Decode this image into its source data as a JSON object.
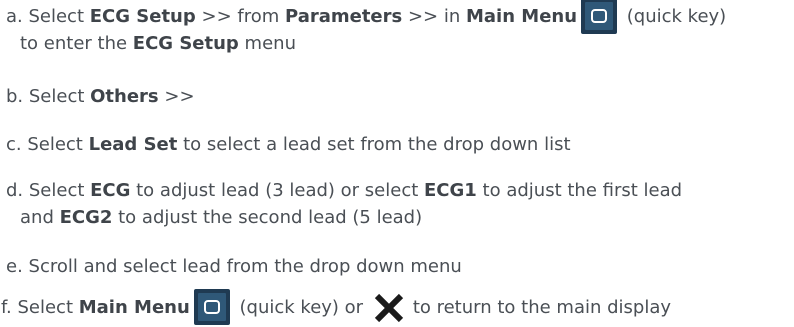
{
  "icons": {
    "quick_key": "main-menu-quick-key-icon",
    "close": "close-icon",
    "quick_key_color": "#1f3a52",
    "close_color": "#1a1a1a"
  },
  "steps": {
    "a": {
      "l1_t1": "a. Select ",
      "l1_b1": "ECG Setup",
      "l1_t2": " >> from ",
      "l1_b2": "Parameters",
      "l1_t3": " >> in ",
      "l1_b3": "Main Menu",
      "l1_t4": " (quick key)",
      "l2_t1": "to enter the ",
      "l2_b1": "ECG Setup",
      "l2_t2": " menu"
    },
    "b": {
      "t1": "b. Select ",
      "b1": "Others",
      "t2": " >>"
    },
    "c": {
      "t1": "c. Select ",
      "b1": "Lead Set",
      "t2": " to select a lead set from the drop down list"
    },
    "d": {
      "l1_t1": "d. Select ",
      "l1_b1": "ECG",
      "l1_t2": " to adjust lead (3 lead) or select ",
      "l1_b2": "ECG1",
      "l1_t3": " to adjust the first lead",
      "l2_t1": "and ",
      "l2_b1": "ECG2",
      "l2_t2": " to adjust the second lead (5 lead)"
    },
    "e": {
      "t1": "e. Scroll and select lead from the drop down menu"
    },
    "f": {
      "t1": "f. Select ",
      "b1": "Main Menu",
      "t2": " (quick key) or ",
      "t3": "to return to the main display"
    }
  }
}
